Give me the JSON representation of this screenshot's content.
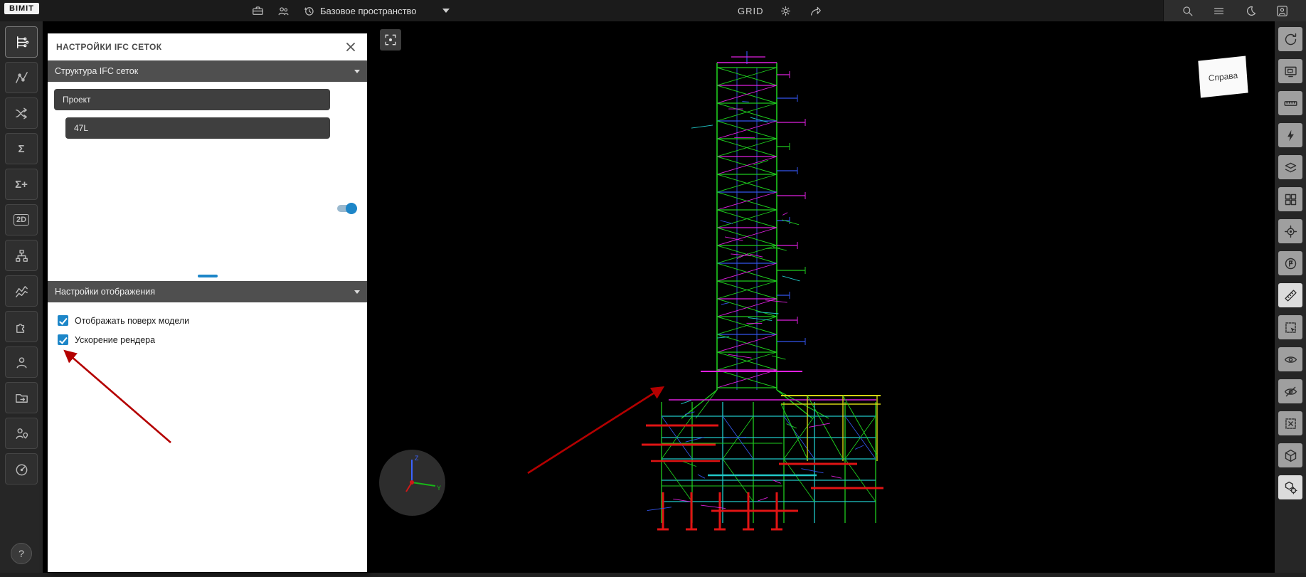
{
  "app": {
    "logo": "BIMIT"
  },
  "topbar": {
    "workspace": "Базовое пространство",
    "grid_label": "GRID"
  },
  "sidebar": {
    "sigma": "Σ",
    "sigma_plus": "Σ+",
    "two_d": "2D",
    "help": "?"
  },
  "panel": {
    "title": "НАСТРОЙКИ IFC СЕТОК",
    "section_structure": "Структура IFC сеток",
    "section_display": "Настройки отображения",
    "tree": [
      {
        "label": "Проект"
      },
      {
        "label": "47L",
        "toggle_on": true
      }
    ],
    "checkboxes": [
      {
        "label": "Отображать поверх модели",
        "checked": true
      },
      {
        "label": "Ускорение рендера",
        "checked": true
      }
    ]
  },
  "viewport": {
    "view_label": "Справа",
    "axes": {
      "z": "Z",
      "y": "Y"
    }
  },
  "colors": {
    "accent_blue": "#1d86c8",
    "annotation_red": "#b40000"
  }
}
